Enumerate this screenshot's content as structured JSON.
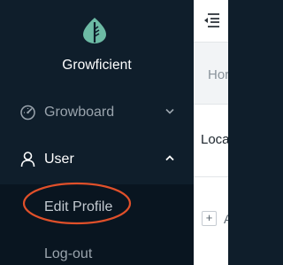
{
  "app": {
    "name": "Growficient"
  },
  "sidebar": {
    "items": [
      {
        "label": "Growboard",
        "icon": "dashboard-icon",
        "chevron": "chevron-down-icon"
      },
      {
        "label": "User",
        "icon": "user-icon",
        "chevron": "chevron-up-icon",
        "expanded": true,
        "children": [
          {
            "label": "Edit Profile",
            "highlighted": true
          },
          {
            "label": "Log-out"
          }
        ]
      }
    ]
  },
  "main": {
    "breadcrumb": {
      "home": "Hor"
    },
    "card": {
      "title": "Loca"
    },
    "add": {
      "icon": "+",
      "label": "A"
    }
  },
  "colors": {
    "sidebar_bg": "#0f1e2b",
    "submenu_bg": "#091520",
    "brand_leaf": "#6dbba5",
    "highlight_ring": "#e0502a"
  }
}
